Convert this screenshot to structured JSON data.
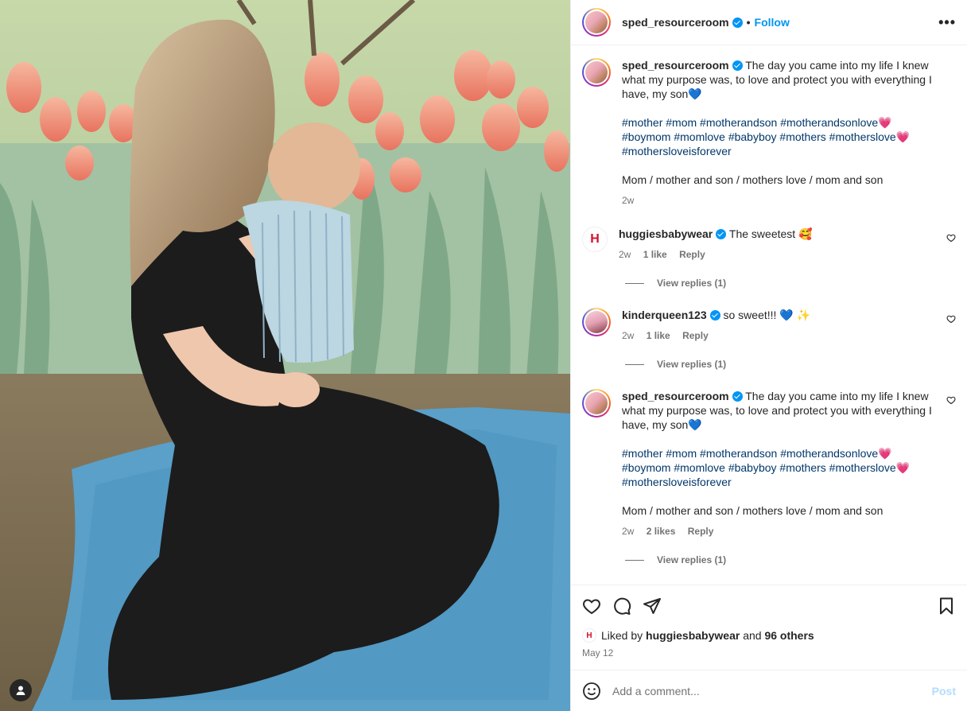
{
  "header": {
    "username": "sped_resourceroom",
    "separator": "•",
    "follow_label": "Follow",
    "more_icon": "more-options-icon"
  },
  "caption": {
    "username": "sped_resourceroom",
    "text": "The day you came into my life I knew what my purpose was, to love and protect you with everything I have, my son💙",
    "hashtags": "#mother #mom #motherandson #motherandsonlove💗 #boymom #momlove #babyboy #mothers #motherslove💗 #mothersloveisforever",
    "extra": "Mom / mother and son / mothers love / mom and son",
    "time": "2w"
  },
  "comments": [
    {
      "username": "huggiesbabywear",
      "text": "The sweetest 🥰",
      "time": "2w",
      "likes": "1 like",
      "reply_label": "Reply",
      "view_replies": "View replies (1)"
    },
    {
      "username": "kinderqueen123",
      "text": "so sweet!!! 💙 ✨",
      "time": "2w",
      "likes": "1 like",
      "reply_label": "Reply",
      "view_replies": "View replies (1)"
    },
    {
      "username": "sped_resourceroom",
      "text": "The day you came into my life I knew what my purpose was, to love and protect you with everything I have, my son💙",
      "hashtags": "#mother #mom #motherandson #motherandsonlove💗 #boymom #momlove #babyboy #mothers #motherslove💗 #mothersloveisforever",
      "extra": "Mom / mother and son / mothers love / mom and son",
      "time": "2w",
      "likes": "2 likes",
      "reply_label": "Reply",
      "view_replies": "View replies (1)"
    }
  ],
  "likes_summary": {
    "prefix": "Liked by",
    "user": "huggiesbabywear",
    "conj": "and",
    "others": "96 others"
  },
  "post_date": "May 12",
  "add_comment": {
    "placeholder": "Add a comment...",
    "post_label": "Post"
  },
  "brand_mark": "H",
  "colors": {
    "link": "#0095f6",
    "hashtag": "#00376b",
    "muted": "#737373",
    "post_disabled": "#b3dbff"
  }
}
